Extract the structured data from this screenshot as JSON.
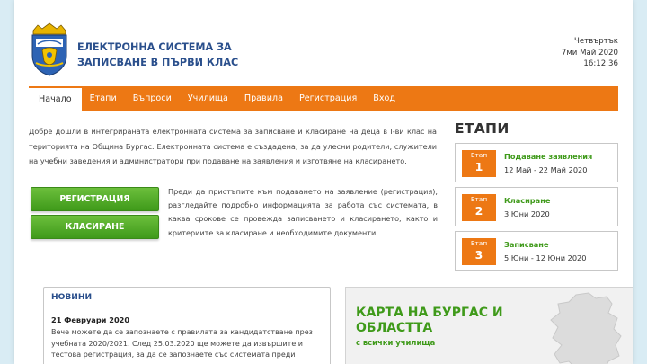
{
  "header": {
    "title_line1": "ЕЛЕКТРОННА СИСТЕМА ЗА",
    "title_line2": "ЗАПИСВАНЕ В ПЪРВИ КЛАС",
    "day": "Четвъртък",
    "date": "7ми Май 2020",
    "time": "16:12:36"
  },
  "nav": {
    "items": [
      {
        "label": "Начало"
      },
      {
        "label": "Етапи"
      },
      {
        "label": "Въпроси"
      },
      {
        "label": "Училища"
      },
      {
        "label": "Правила"
      },
      {
        "label": "Регистрация"
      },
      {
        "label": "Вход"
      }
    ],
    "active_index": 0
  },
  "intro": {
    "text": "Добре дошли в интегрираната електронната система за записване и класиране на деца в I-ви клас на територията на Община Бургас. Електронната система е създадена, за да улесни родители, служители на учебни заведения и администратори при подаване на заявления и изготвяне на класирането."
  },
  "buttons": {
    "register": "РЕГИСТРАЦИЯ",
    "ranking": "КЛАСИРАНЕ"
  },
  "side_text": "Преди да пристъпите към подаването на заявление (регистрация), разгледайте подробно информацията за работа със системата, в каква срокове се провежда записването и класирането, както и критериите за класиране и необходимите документи.",
  "stages": {
    "title": "ЕТАПИ",
    "items": [
      {
        "label": "Етап",
        "num": "1",
        "name": "Подаване заявления",
        "date": "12 Май - 22 Май 2020"
      },
      {
        "label": "Етап",
        "num": "2",
        "name": "Класиране",
        "date": "3 Юни 2020"
      },
      {
        "label": "Етап",
        "num": "3",
        "name": "Записване",
        "date": "5 Юни - 12 Юни 2020"
      }
    ]
  },
  "news": {
    "title": "НОВИНИ",
    "date": "21 Февруари 2020",
    "text": "Вече можете да се запознаете с правилата за кандидатстване през учебната 2020/2021. След 25.03.2020 ще можете да извършите и тестова регистрация, за да се запознаете със системата преди"
  },
  "map": {
    "title": "КАРТА НА БУРГАС И ОБЛАСТТА",
    "subtitle": "с всички училища"
  },
  "colors": {
    "accent": "#ed7814",
    "green": "#3f9a1a",
    "title_blue": "#2a4f8c",
    "background": "#d9ecf4"
  }
}
